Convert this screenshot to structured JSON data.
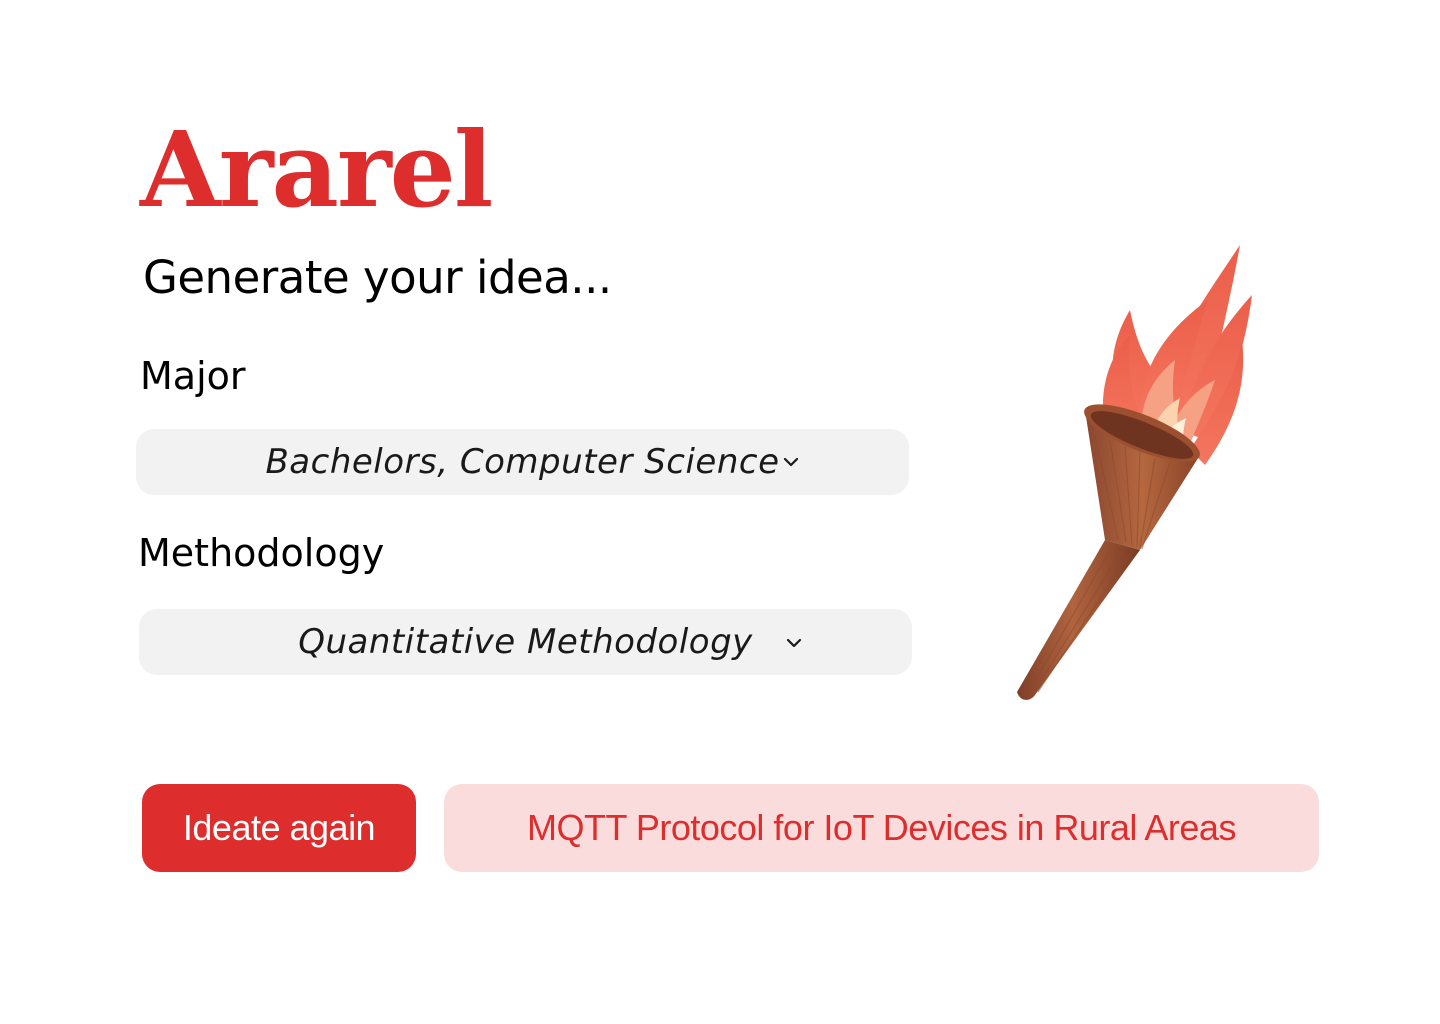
{
  "app": {
    "logo_text": "Ararel",
    "tagline": "Generate your idea..."
  },
  "form": {
    "major": {
      "label": "Major",
      "selected": "Bachelors, Computer Science"
    },
    "methodology": {
      "label": "Methodology",
      "selected": "Quantitative Methodology"
    }
  },
  "actions": {
    "ideate_label": "Ideate again"
  },
  "result": {
    "idea": "MQTT Protocol for IoT Devices in Rural Areas"
  },
  "icons": {
    "dropdown": "chevron-down-icon",
    "illustration": "torch-icon"
  },
  "colors": {
    "brand": "#DE2D2D",
    "result_bg": "#FADCDC",
    "select_bg": "#F2F2F2",
    "torch_handle": "#A3583A",
    "flame": "#F0705C"
  }
}
